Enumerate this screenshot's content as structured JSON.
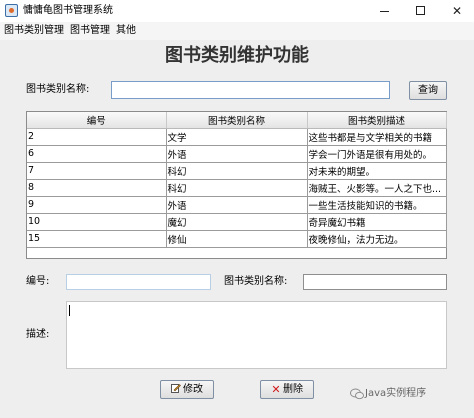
{
  "window": {
    "title": "慵慵龟图书管理系统",
    "minimize": "minimize-icon",
    "maximize": "maximize-icon",
    "close": "✕"
  },
  "menu": [
    "图书类别管理",
    "图书管理",
    "其他"
  ],
  "page_title": "图书类别维护功能",
  "search": {
    "label": "图书类别名称:",
    "value": "",
    "button": "查询"
  },
  "table": {
    "headers": [
      "编号",
      "图书类别名称",
      "图书类别描述"
    ],
    "rows": [
      [
        "2",
        "文学",
        "这些书都是与文学相关的书籍"
      ],
      [
        "6",
        "外语",
        "学会一门外语是很有用处的。"
      ],
      [
        "7",
        "科幻",
        "对未来的期望。"
      ],
      [
        "8",
        "科幻",
        "海贼王、火影等。一人之下也..."
      ],
      [
        "9",
        "外语",
        "一些生活技能知识的书籍。"
      ],
      [
        "10",
        "魔幻",
        "奇异魔幻书籍"
      ],
      [
        "15",
        "修仙",
        "夜晚修仙，法力无边。"
      ]
    ]
  },
  "form": {
    "id_label": "编号:",
    "id_value": "",
    "name_label": "图书类别名称:",
    "name_value": "",
    "desc_label": "描述:",
    "desc_value": ""
  },
  "actions": {
    "edit": "修改",
    "delete": "删除"
  },
  "watermark": "Java实例程序",
  "colors": {
    "field_border": "#7a9cc9",
    "delete_icon": "#d21a1a",
    "window_bg": "#eeeeee"
  }
}
